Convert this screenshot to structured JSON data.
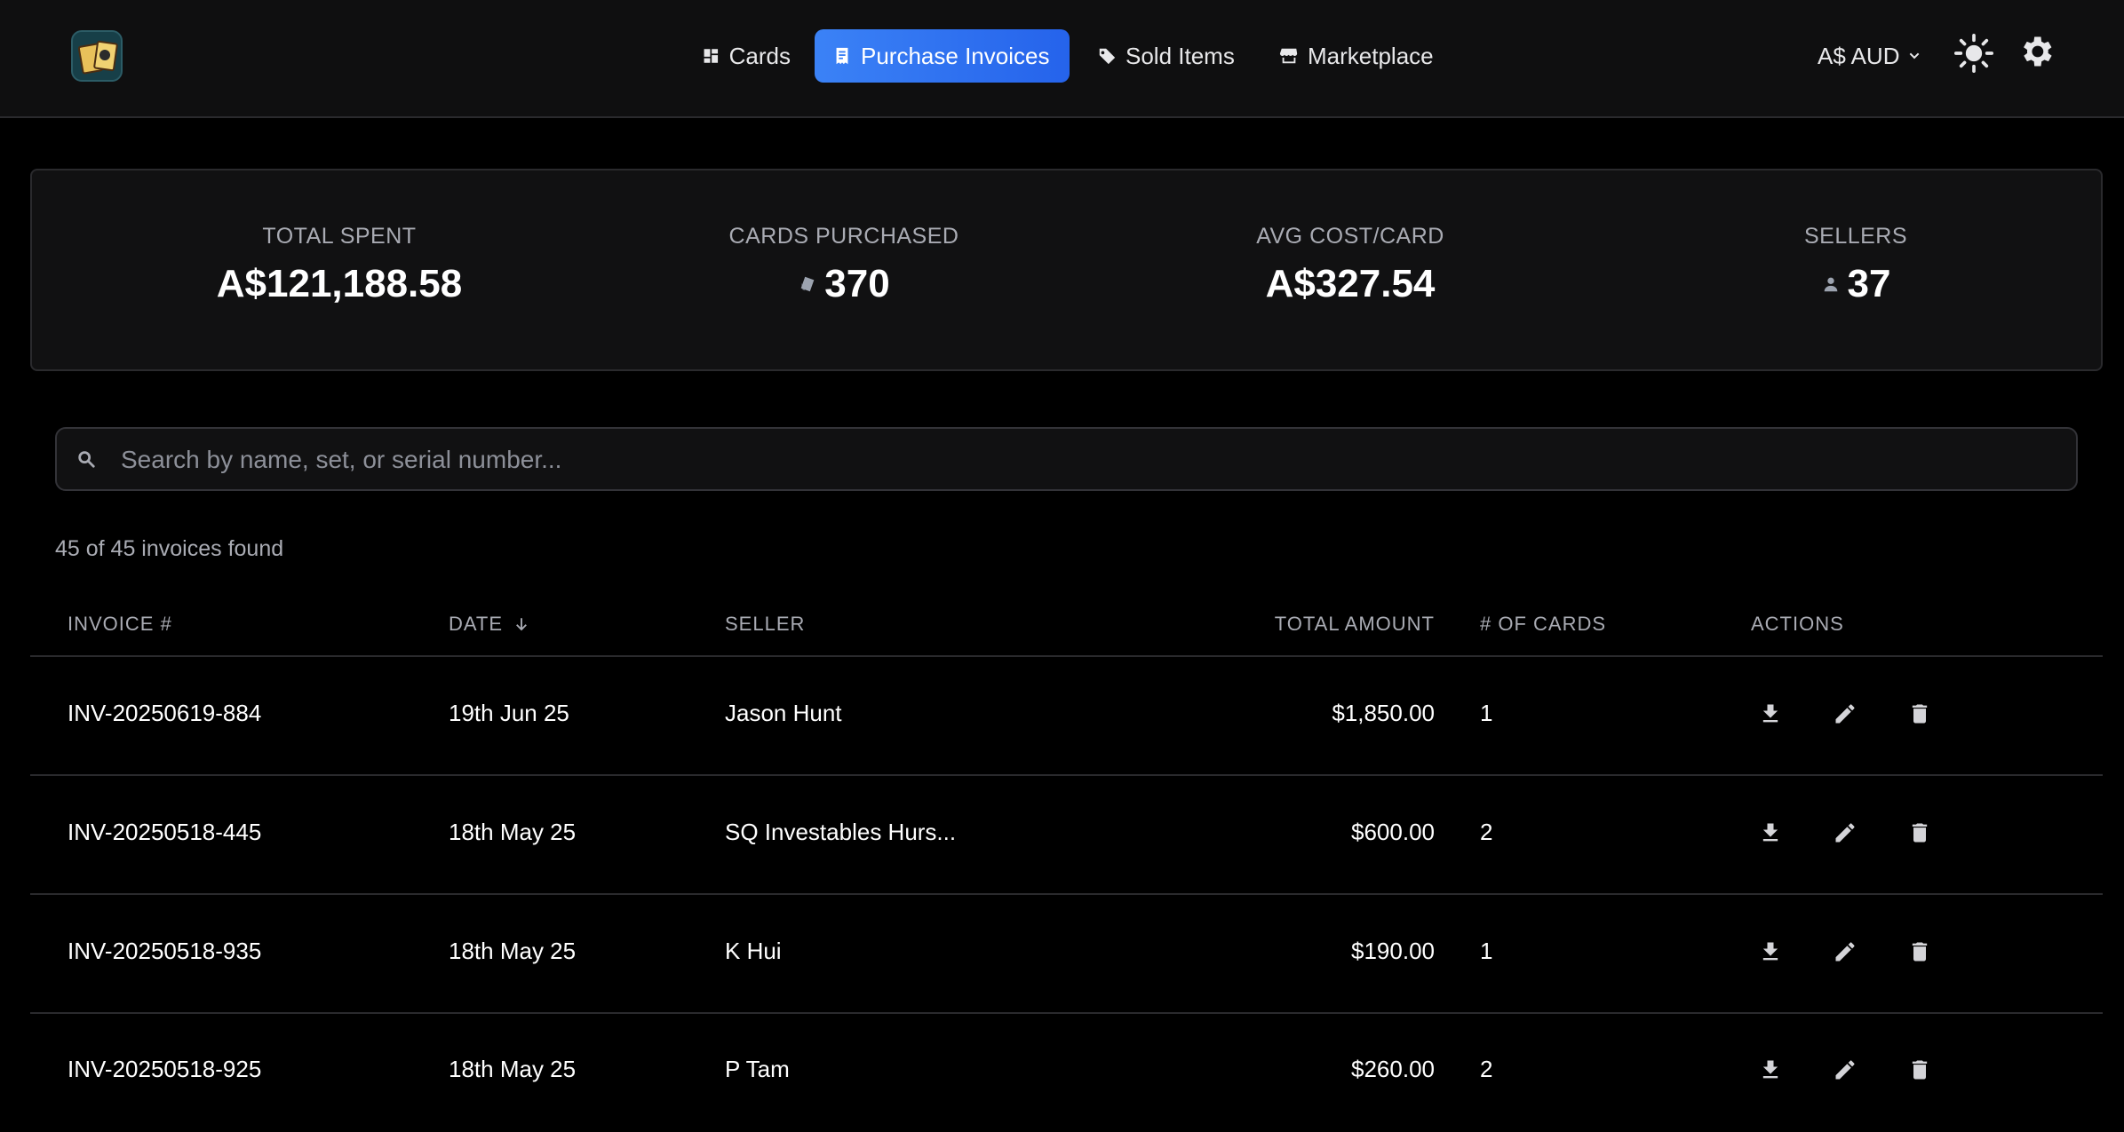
{
  "header": {
    "nav": [
      {
        "label": "Cards",
        "icon": "grid-icon",
        "active": false
      },
      {
        "label": "Purchase Invoices",
        "icon": "receipt-icon",
        "active": true
      },
      {
        "label": "Sold Items",
        "icon": "tag-icon",
        "active": false
      },
      {
        "label": "Marketplace",
        "icon": "storefront-icon",
        "active": false
      }
    ],
    "currency": "A$ AUD",
    "accent": "#3b82f6"
  },
  "stats": [
    {
      "label": "TOTAL SPENT",
      "value": "A$121,188.58"
    },
    {
      "label": "CARDS PURCHASED",
      "value": "370",
      "icon": "cards-icon"
    },
    {
      "label": "AVG COST/CARD",
      "value": "A$327.54"
    },
    {
      "label": "SELLERS",
      "value": "37",
      "icon": "person-icon"
    }
  ],
  "search": {
    "placeholder": "Search by name, set, or serial number...",
    "value": ""
  },
  "results_count": "45 of 45 invoices found",
  "table": {
    "columns": {
      "invoice": "INVOICE #",
      "date": "DATE",
      "seller": "SELLER",
      "total": "TOTAL AMOUNT",
      "cards": "# OF CARDS",
      "actions": "ACTIONS"
    },
    "sort": {
      "column": "date",
      "direction": "descending"
    },
    "rows": [
      {
        "invoice": "INV-20250619-884",
        "date": "19th Jun 25",
        "seller": "Jason Hunt",
        "total": "$1,850.00",
        "cards": "1"
      },
      {
        "invoice": "INV-20250518-445",
        "date": "18th May 25",
        "seller": "SQ Investables Hurs...",
        "total": "$600.00",
        "cards": "2"
      },
      {
        "invoice": "INV-20250518-935",
        "date": "18th May 25",
        "seller": "K Hui",
        "total": "$190.00",
        "cards": "1"
      },
      {
        "invoice": "INV-20250518-925",
        "date": "18th May 25",
        "seller": "P Tam",
        "total": "$260.00",
        "cards": "2"
      }
    ]
  }
}
